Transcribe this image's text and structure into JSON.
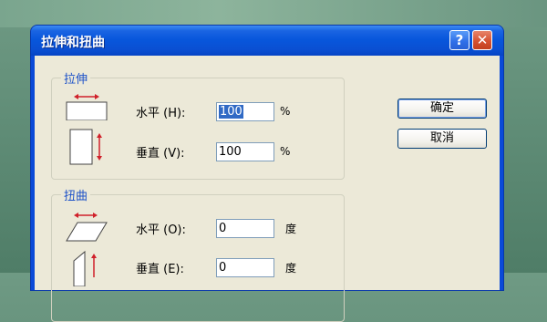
{
  "window": {
    "title": "拉伸和扭曲",
    "help_glyph": "?",
    "close_glyph": "✕"
  },
  "stretch": {
    "title": "拉伸",
    "horizontal": {
      "label": "水平 (H):",
      "value": "100",
      "unit": "%"
    },
    "vertical": {
      "label": "垂直 (V):",
      "value": "100",
      "unit": "%"
    }
  },
  "skew": {
    "title": "扭曲",
    "horizontal": {
      "label": "水平 (O):",
      "value": "0",
      "unit": "度"
    },
    "vertical": {
      "label": "垂直 (E):",
      "value": "0",
      "unit": "度"
    }
  },
  "buttons": {
    "ok": "确定",
    "cancel": "取消"
  },
  "colors": {
    "titlebar": "#0857dc",
    "dialog_bg": "#ece9d8",
    "group_title": "#1e52c8",
    "arrow": "#d0202a"
  },
  "icons": [
    "stretch-horizontal-icon",
    "stretch-vertical-icon",
    "skew-horizontal-icon",
    "skew-vertical-icon"
  ]
}
